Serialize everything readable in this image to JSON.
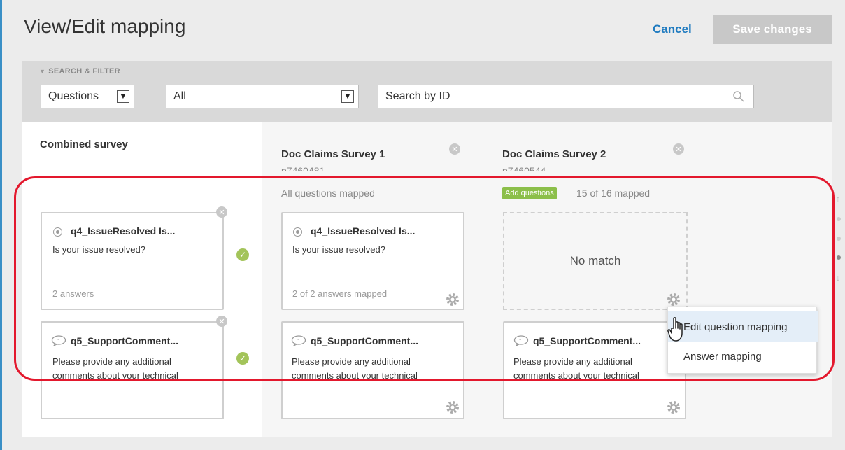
{
  "header": {
    "title": "View/Edit mapping",
    "cancel_label": "Cancel",
    "save_label": "Save changes"
  },
  "filter": {
    "label": "SEARCH & FILTER",
    "type_select": "Questions",
    "scope_select": "All",
    "search_placeholder": "Search by ID"
  },
  "columns": [
    {
      "title": "Combined survey",
      "cards": [
        {
          "title": "q4_IssueResolved Is...",
          "text": "Is your issue resolved?",
          "meta": "2 answers"
        },
        {
          "title": "q5_SupportComment...",
          "text": "Please provide any additional comments about your technical"
        }
      ]
    },
    {
      "title": "Doc Claims Survey 1",
      "id": "p7460481",
      "status": "All questions mapped",
      "cards": [
        {
          "title": "q4_IssueResolved Is...",
          "text": "Is your issue resolved?",
          "meta": "2 of 2 answers mapped"
        },
        {
          "title": "q5_SupportComment...",
          "text": "Please provide any additional comments about your technical"
        }
      ]
    },
    {
      "title": "Doc Claims Survey 2",
      "id": "p7460544",
      "add_label": "Add questions",
      "status": "15 of 16 mapped",
      "no_match": "No match",
      "cards": [
        {
          "title": "q5_SupportComment...",
          "text": "Please provide any additional comments about your technical"
        }
      ]
    }
  ],
  "context_menu": {
    "items": [
      "Edit question mapping",
      "Answer mapping"
    ]
  },
  "colors": {
    "accent_link": "#1f7bc0",
    "check_green": "#a3c45a",
    "add_badge": "#8cbf4a",
    "highlight": "#e3182d"
  }
}
